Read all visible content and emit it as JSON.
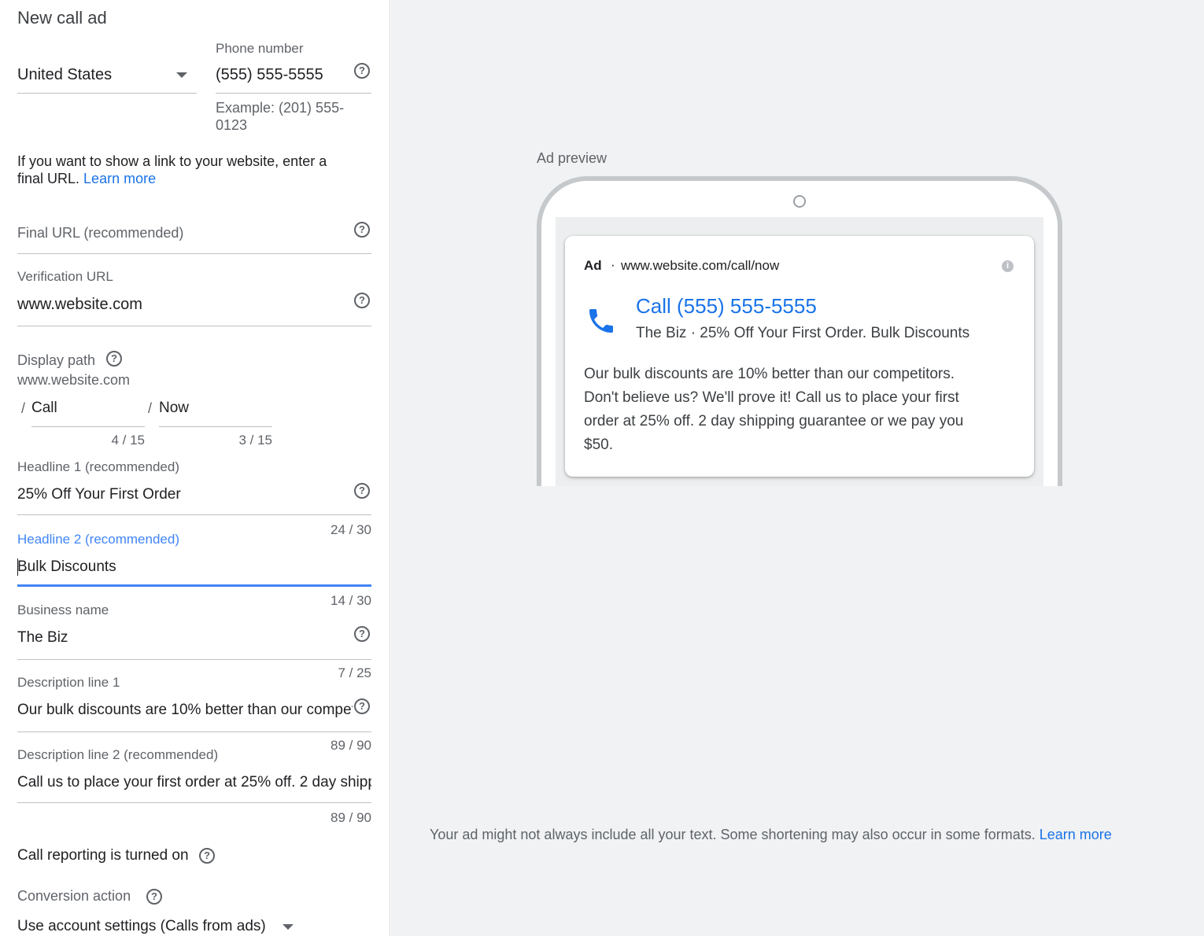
{
  "form": {
    "title": "New call ad",
    "country": {
      "value": "United States"
    },
    "phone": {
      "label": "Phone number",
      "value": "(555) 555-5555",
      "hint_line1": "Example: (201) 555-",
      "hint_line2": "0123"
    },
    "url_info": {
      "text_line1": "If you want to show a link to your website, enter a",
      "text_line2": "final URL.",
      "learn_more": "Learn more"
    },
    "final_url": {
      "placeholder": "Final URL (recommended)"
    },
    "verification_url": {
      "label": "Verification URL",
      "value": "www.website.com"
    },
    "display_path": {
      "label": "Display path",
      "domain": "www.website.com",
      "path1": {
        "slash": "/",
        "value": "Call",
        "counter": "4 / 15"
      },
      "path2": {
        "slash": "/",
        "value": "Now",
        "counter": "3 / 15"
      }
    },
    "headline1": {
      "label": "Headline 1 (recommended)",
      "value": "25% Off Your First Order",
      "counter": "24 / 30"
    },
    "headline2": {
      "label": "Headline 2 (recommended)",
      "value": "Bulk Discounts",
      "counter": "14 / 30"
    },
    "business_name": {
      "label": "Business name",
      "value": "The Biz",
      "counter": "7 / 25"
    },
    "description1": {
      "label": "Description line 1",
      "value": "Our bulk discounts are 10% better than our competitors. Don't believe us? We'll prove it!",
      "counter": "89 / 90"
    },
    "description2": {
      "label": "Description line 2 (recommended)",
      "value": "Call us to place your first order at 25% off. 2 day shipping guarantee or we pay you $50.",
      "counter": "89 / 90"
    },
    "call_reporting": {
      "label": "Call reporting is turned on"
    },
    "conversion_action": {
      "label": "Conversion action",
      "value": "Use account settings (Calls from ads)"
    }
  },
  "preview": {
    "title": "Ad preview",
    "ad_badge": "Ad",
    "separator": "·",
    "display_url": "www.website.com/call/now",
    "headline": "Call (555) 555-5555",
    "subline": "The Biz · 25% Off Your First Order. Bulk Discounts",
    "description_lines": [
      "Our bulk discounts are 10% better than our competitors.",
      "Don't believe us? We'll prove it! Call us to place your first",
      "order at 25% off. 2 day shipping guarantee or we pay you",
      "$50."
    ],
    "disclaimer": "Your ad might not always include all your text. Some shortening may also occur in some formats.",
    "disclaimer_link": "Learn more"
  },
  "colors": {
    "link": "#1a73e8",
    "focus_underline": "#4285f4",
    "preview_bg": "#f0f2f3"
  },
  "icons": {
    "help": "help-circle-icon",
    "dropdown": "caret-down-icon",
    "phone": "phone-icon",
    "info": "info-icon"
  }
}
